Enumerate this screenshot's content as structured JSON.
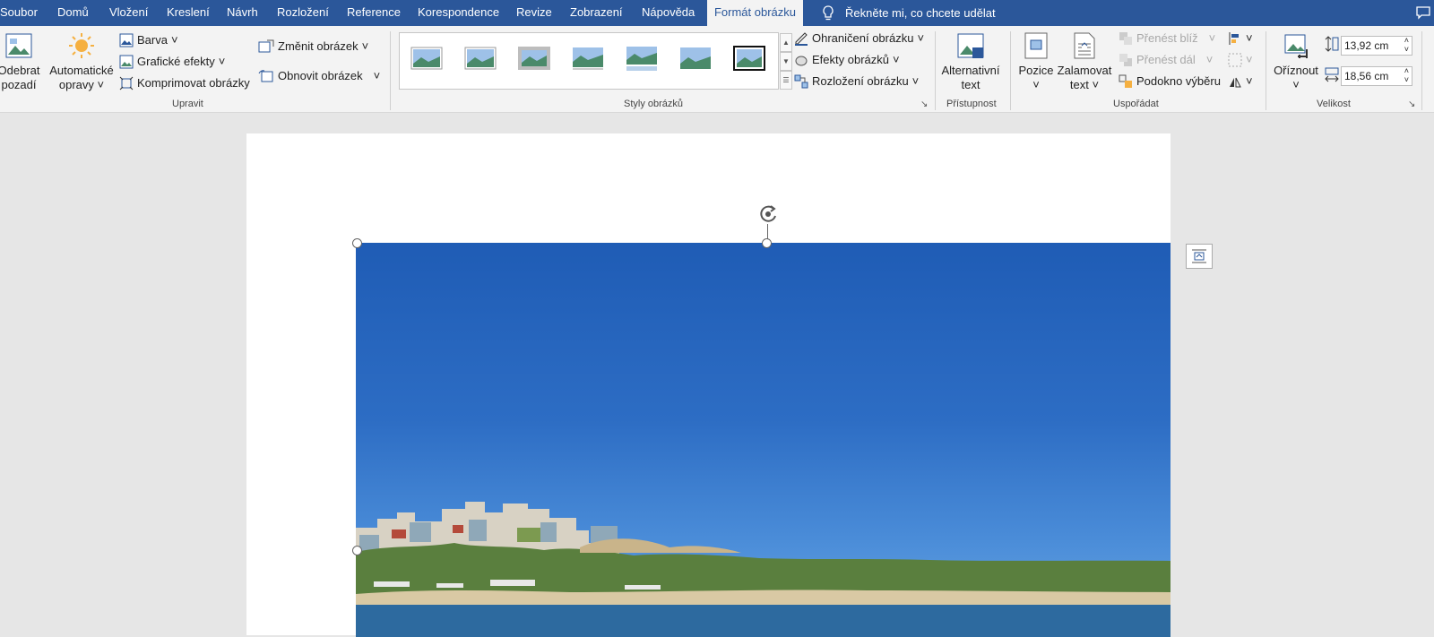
{
  "tabs": [
    "Soubor",
    "Domů",
    "Vložení",
    "Kreslení",
    "Návrh",
    "Rozložení",
    "Reference",
    "Korespondence",
    "Revize",
    "Zobrazení",
    "Nápověda",
    "Formát obrázku"
  ],
  "tell_me": "Řekněte mi, co chcete udělat",
  "adjust": {
    "remove_bg_line1": "Odebrat",
    "remove_bg_line2": "pozadí",
    "auto_line1": "Automatické",
    "auto_line2": "opravy",
    "color": "Barva",
    "artistic": "Grafické efekty",
    "compress": "Komprimovat obrázky",
    "change": "Změnit obrázek",
    "reset": "Obnovit obrázek",
    "group": "Upravit"
  },
  "styles": {
    "group": "Styly obrázků",
    "border": "Ohraničení obrázku",
    "effects": "Efekty obrázků",
    "layout": "Rozložení obrázku"
  },
  "access": {
    "alt_line1": "Alternativní",
    "alt_line2": "text",
    "group": "Přístupnost"
  },
  "arrange": {
    "position": "Pozice",
    "wrap_line1": "Zalamovat",
    "wrap_line2": "text",
    "forward": "Přenést blíž",
    "backward": "Přenést dál",
    "pane": "Podokno výběru",
    "group": "Uspořádat"
  },
  "size": {
    "crop": "Oříznout",
    "height": "13,92 cm",
    "width": "18,56 cm",
    "group": "Velikost"
  },
  "colors": {
    "accent": "#2b579a",
    "ribbon": "#f3f3f3"
  }
}
